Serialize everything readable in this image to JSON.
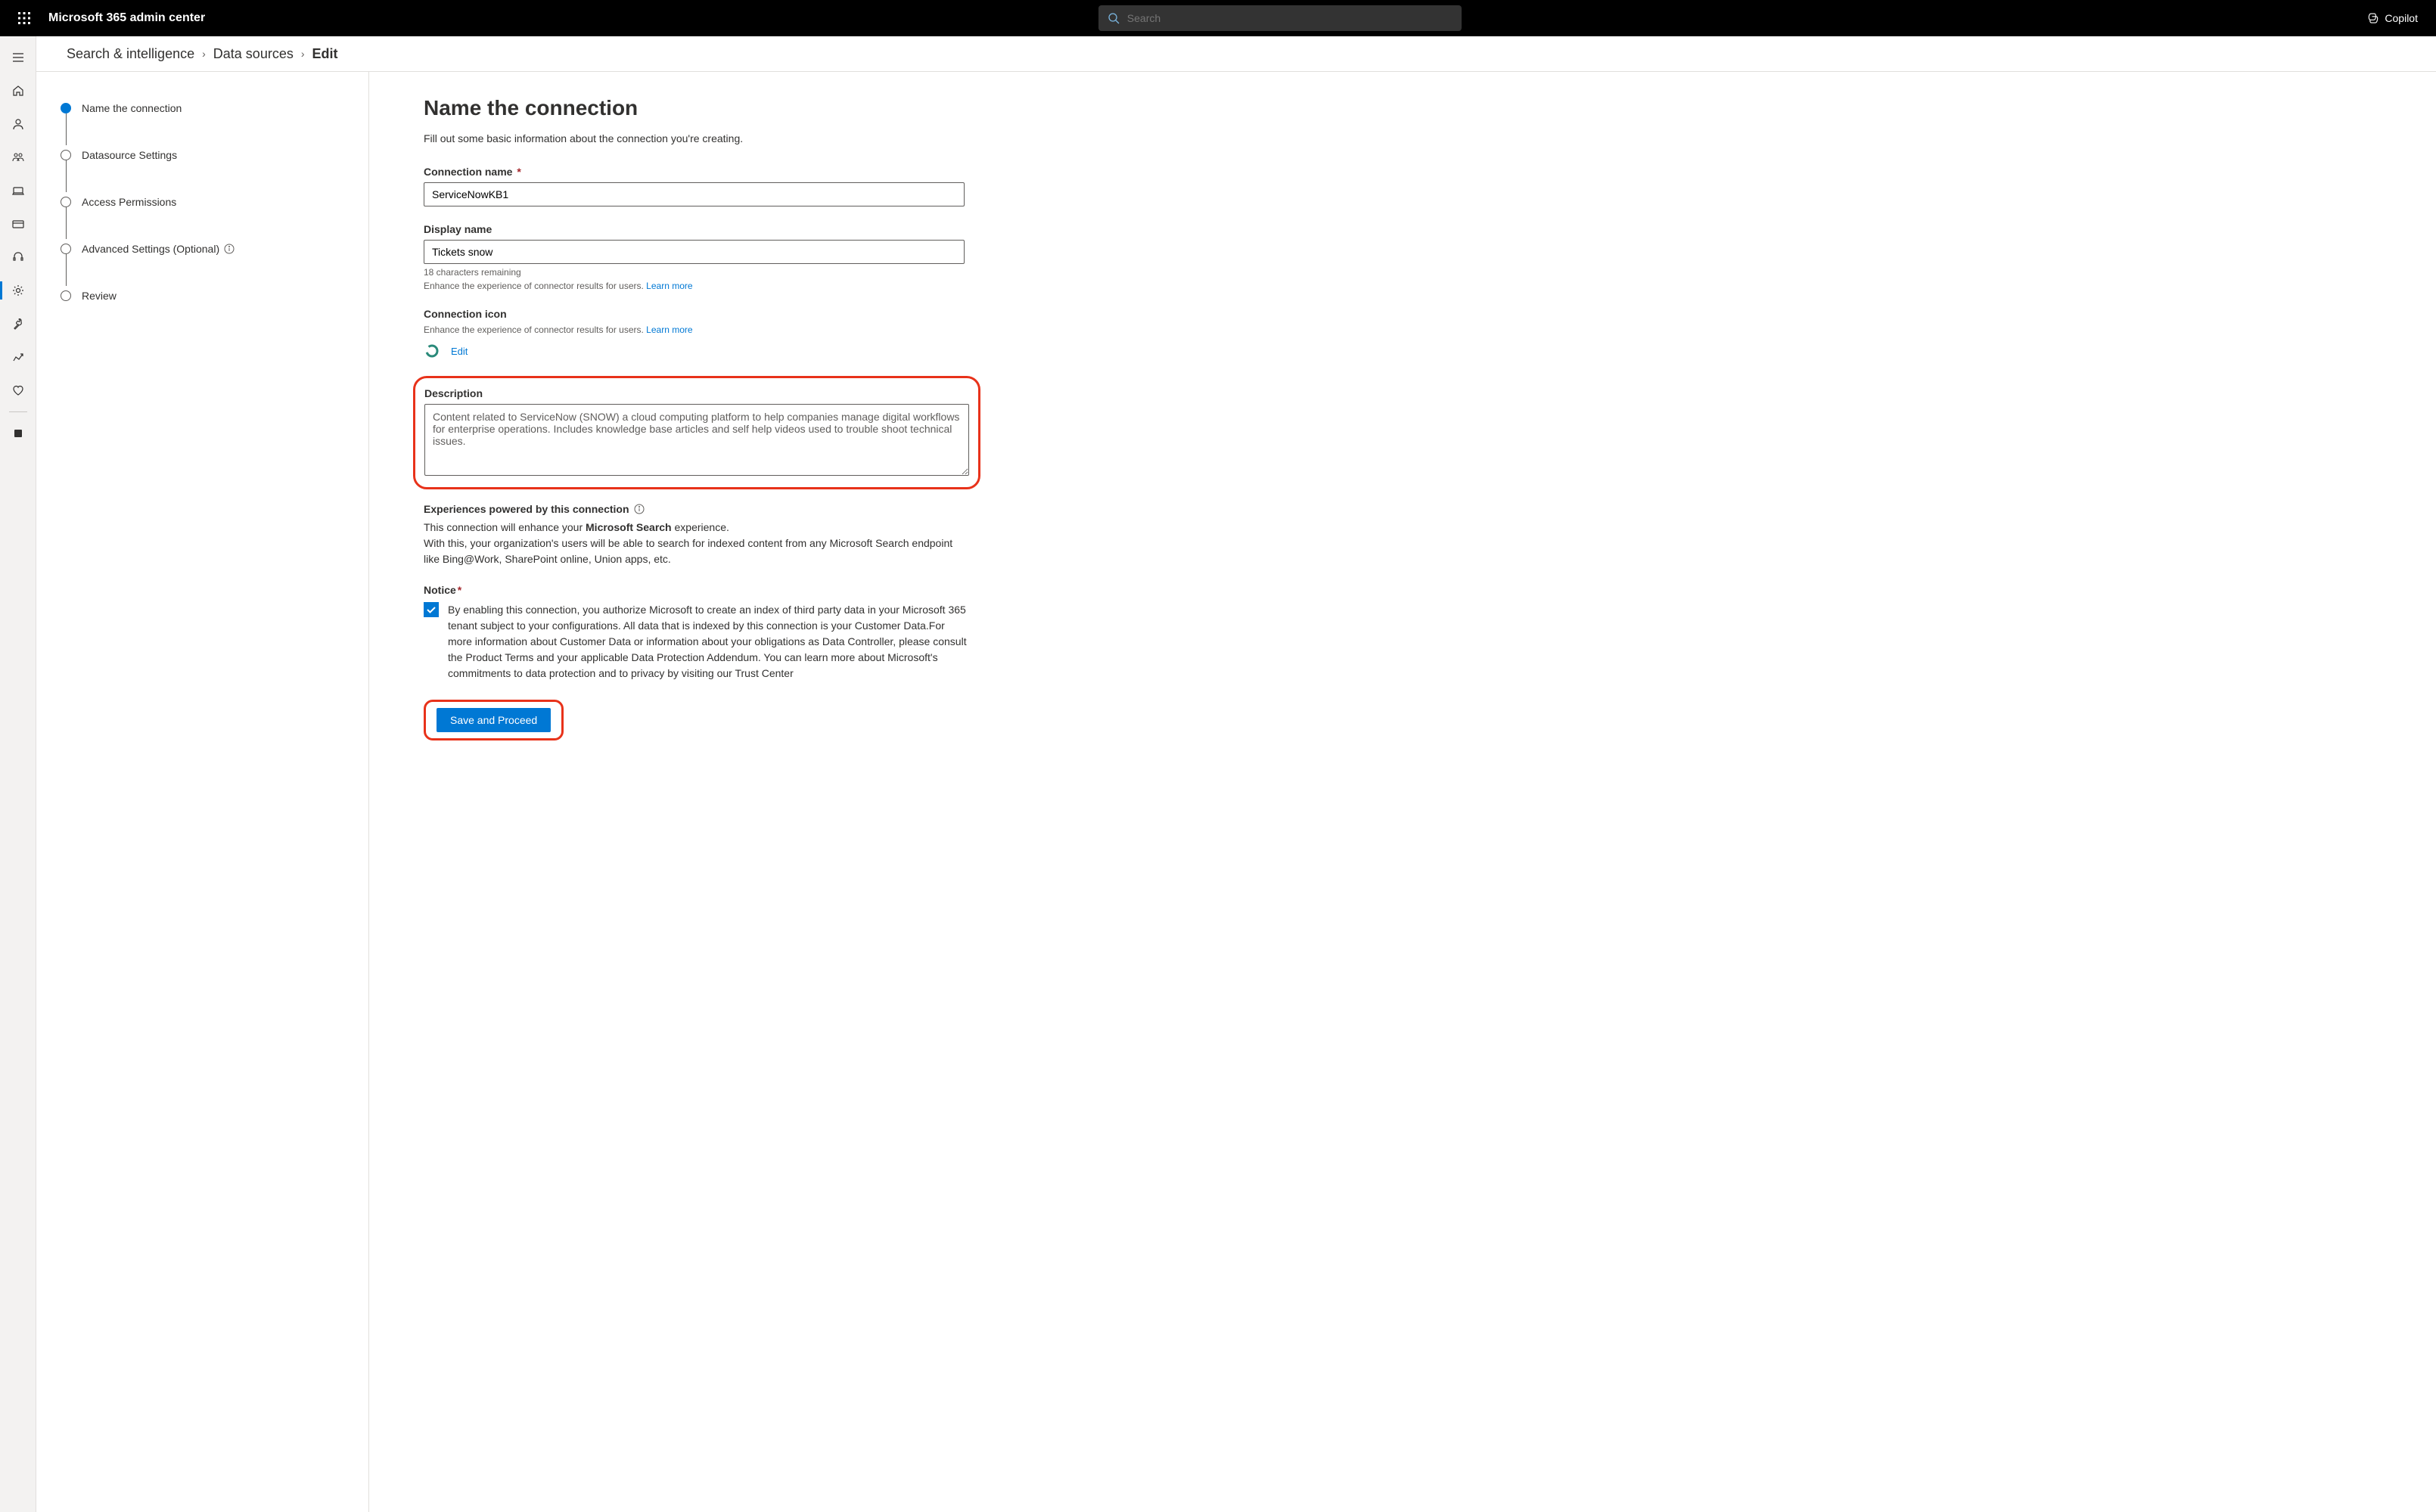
{
  "header": {
    "app_title": "Microsoft 365 admin center",
    "search_placeholder": "Search",
    "copilot_label": "Copilot"
  },
  "breadcrumb": {
    "item1": "Search & intelligence",
    "item2": "Data sources",
    "current": "Edit"
  },
  "steps": [
    {
      "label": "Name the connection",
      "active": true
    },
    {
      "label": "Datasource Settings",
      "active": false
    },
    {
      "label": "Access Permissions",
      "active": false
    },
    {
      "label": "Advanced Settings (Optional)",
      "active": false,
      "info": true
    },
    {
      "label": "Review",
      "active": false
    }
  ],
  "form": {
    "title": "Name the connection",
    "subtitle": "Fill out some basic information about the connection you're creating.",
    "connection_name_label": "Connection name",
    "connection_name_value": "ServiceNowKB1",
    "display_name_label": "Display name",
    "display_name_value": "Tickets snow",
    "display_name_helper": "18 characters remaining",
    "display_name_helper2_prefix": "Enhance the experience of connector results for users. ",
    "learn_more": "Learn more",
    "connection_icon_label": "Connection icon",
    "connection_icon_helper_prefix": "Enhance the experience of connector results for users. ",
    "edit_link": "Edit",
    "description_label": "Description",
    "description_value": "Content related to ServiceNow (SNOW) a cloud computing platform to help companies manage digital workflows for enterprise operations. Includes knowledge base articles and self help videos used to trouble shoot technical issues.",
    "experiences_label": "Experiences powered by this connection",
    "experiences_line1_prefix": "This connection will enhance your ",
    "experiences_line1_bold": "Microsoft Search",
    "experiences_line1_suffix": " experience.",
    "experiences_line2": "With this, your organization's users will be able to search for indexed content from any Microsoft Search endpoint like Bing@Work, SharePoint online, Union apps, etc.",
    "notice_label": "Notice",
    "notice_text": "By enabling this connection, you authorize Microsoft to create an index of third party data in your Microsoft 365 tenant subject to your configurations. All data that is indexed by this connection is your Customer Data.For more information about Customer Data or information about your obligations as Data Controller, please consult the Product Terms and your applicable Data Protection Addendum. You can learn more about Microsoft's commitments to data protection and to privacy by visiting our Trust Center",
    "save_button": "Save and Proceed"
  }
}
